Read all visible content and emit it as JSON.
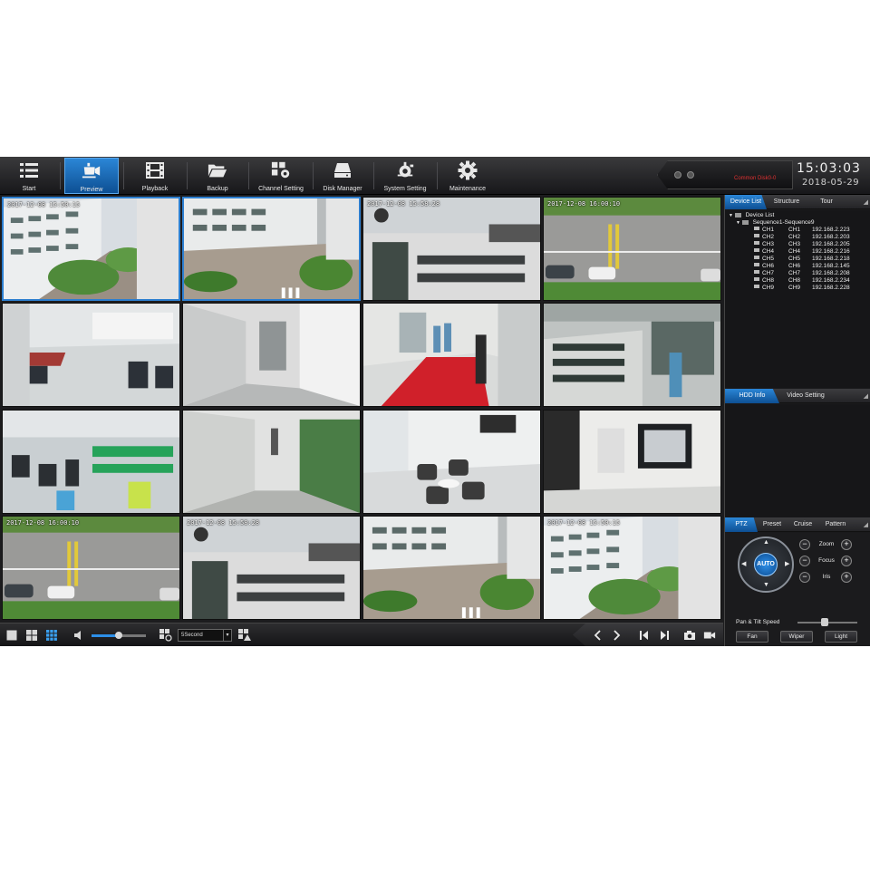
{
  "toolbar": {
    "items": [
      {
        "label": "Start",
        "icon": "grid-menu-icon"
      },
      {
        "label": "Preview",
        "icon": "camera-icon"
      },
      {
        "label": "Playback",
        "icon": "film-icon"
      },
      {
        "label": "Backup",
        "icon": "folder-icon"
      },
      {
        "label": "Channel Setting",
        "icon": "channel-gear-icon"
      },
      {
        "label": "Disk Manager",
        "icon": "disk-icon"
      },
      {
        "label": "System Setting",
        "icon": "system-gear-icon"
      },
      {
        "label": "Maintenance",
        "icon": "gear-icon"
      }
    ],
    "active": "Preview",
    "accent": "#1f6fbf"
  },
  "status": {
    "message": "Common Disk0-0",
    "message_color": "#e03232",
    "time": "15:03:03",
    "date": "2018-05-29"
  },
  "tiles": [
    {
      "timestamp": "2017-12-08 15:50:15"
    },
    {
      "timestamp": ""
    },
    {
      "timestamp": "2017-12-08 15:58:28"
    },
    {
      "timestamp": "2017-12-08 16:00:10"
    },
    {
      "timestamp": ""
    },
    {
      "timestamp": ""
    },
    {
      "timestamp": ""
    },
    {
      "timestamp": ""
    },
    {
      "timestamp": ""
    },
    {
      "timestamp": ""
    },
    {
      "timestamp": ""
    },
    {
      "timestamp": ""
    },
    {
      "timestamp": "2017-12-08 16:00:10"
    },
    {
      "timestamp": "2017-12-08 15:58:28"
    },
    {
      "timestamp": ""
    },
    {
      "timestamp": "2017-12-08 15:50:15"
    }
  ],
  "bottombar": {
    "interval": "5Second",
    "volume": 0.5
  },
  "device_panel": {
    "tabs": [
      "Device List",
      "Structure",
      "Tour"
    ],
    "root": "Device List",
    "group": "Sequence1-Sequence9",
    "channels": [
      {
        "name": "CH1",
        "ch": "CH1",
        "ip": "192.168.2.223"
      },
      {
        "name": "CH2",
        "ch": "CH2",
        "ip": "192.168.2.203"
      },
      {
        "name": "CH3",
        "ch": "CH3",
        "ip": "192.168.2.205"
      },
      {
        "name": "CH4",
        "ch": "CH4",
        "ip": "192.168.2.216"
      },
      {
        "name": "CH5",
        "ch": "CH5",
        "ip": "192.168.2.218"
      },
      {
        "name": "CH6",
        "ch": "CH6",
        "ip": "192.168.2.145"
      },
      {
        "name": "CH7",
        "ch": "CH7",
        "ip": "192.168.2.208"
      },
      {
        "name": "CH8",
        "ch": "CH8",
        "ip": "192.168.2.234"
      },
      {
        "name": "CH9",
        "ch": "CH9",
        "ip": "192.168.2.228"
      }
    ]
  },
  "info_panel": {
    "tabs": [
      "HDD Info",
      "Video Setting"
    ]
  },
  "ptz_panel": {
    "tabs": [
      "PTZ",
      "Preset",
      "Cruise",
      "Pattern"
    ],
    "auto_label": "AUTO",
    "controls": [
      "Zoom",
      "Focus",
      "Iris"
    ],
    "speed_label": "Pan & Tilt Speed",
    "speed": 0.45,
    "buttons": [
      "Fan",
      "Wiper",
      "Light"
    ]
  }
}
